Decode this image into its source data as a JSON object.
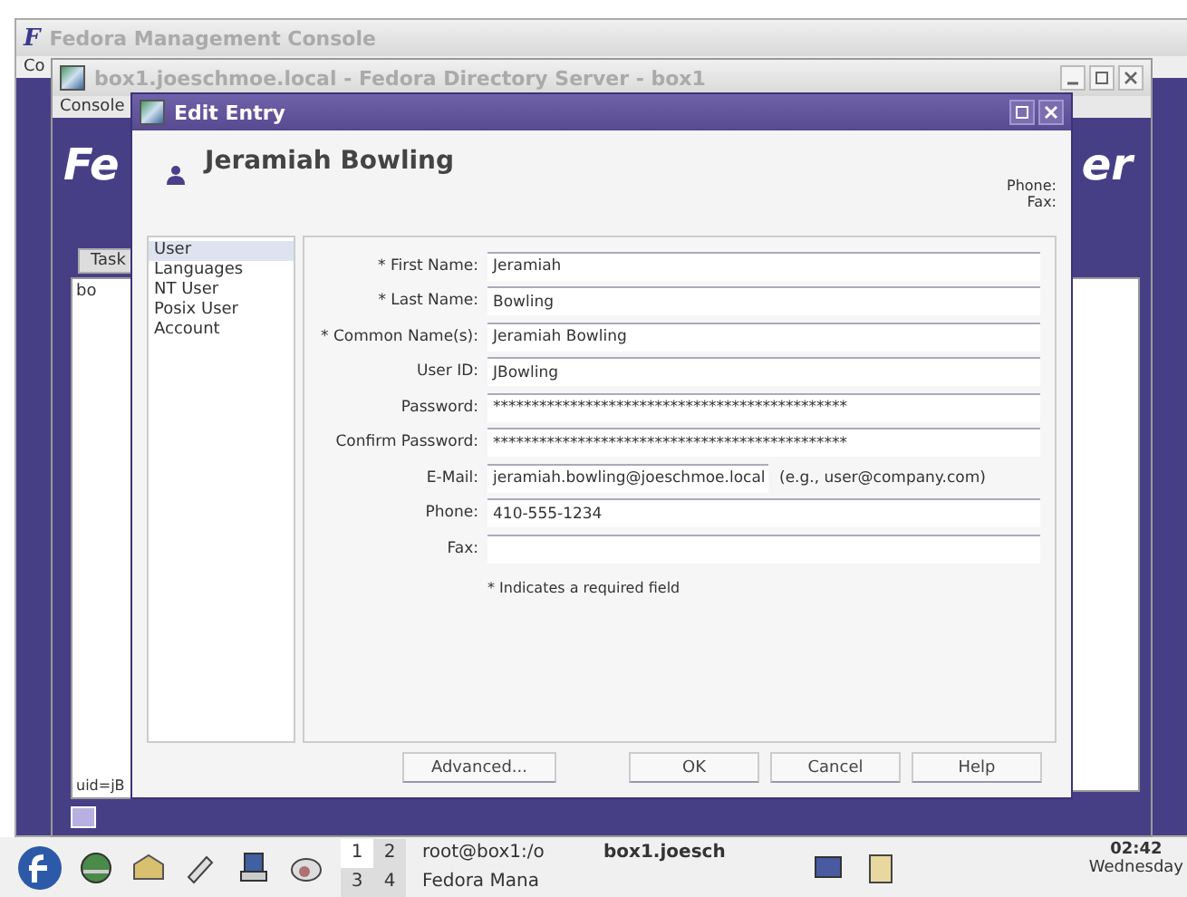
{
  "main_window": {
    "logo": "F",
    "title": "Fedora Management Console",
    "menu": "Co"
  },
  "server_window": {
    "title": "box1.joeschmoe.local - Fedora Directory Server - box1",
    "menu": "Console",
    "banner_left": "Fe",
    "banner_right": "er",
    "tab": "Task",
    "tree_label": "bo",
    "status_text": "uid=jB"
  },
  "dialog": {
    "title": "Edit Entry",
    "name": "Jeramiah Bowling",
    "phone_label": "Phone:",
    "fax_label": "Fax:",
    "sections": [
      {
        "label": "User",
        "selected": true
      },
      {
        "label": "Languages",
        "selected": false
      },
      {
        "label": "NT User",
        "selected": false
      },
      {
        "label": "Posix User",
        "selected": false
      },
      {
        "label": "Account",
        "selected": false
      }
    ],
    "fields": [
      {
        "label": "* First Name:",
        "value": "Jeramiah"
      },
      {
        "label": "* Last Name:",
        "value": "Bowling"
      },
      {
        "label": "* Common Name(s):",
        "value": "Jeramiah Bowling"
      },
      {
        "label": "User ID:",
        "value": "JBowling"
      },
      {
        "label": "Password:",
        "value": "**********************************************"
      },
      {
        "label": "Confirm Password:",
        "value": "**********************************************"
      },
      {
        "label": "E-Mail:",
        "value": "jeramiah.bowling@joeschmoe.local",
        "hint": "(e.g., user@company.com)"
      },
      {
        "label": "Phone:",
        "value": "410-555-1234"
      },
      {
        "label": "Fax:"
      }
    ],
    "required_note": "* Indicates a required field",
    "buttons": [
      "Advanced...",
      "OK",
      "Cancel",
      "Help"
    ]
  },
  "taskbar": {
    "workspaces": [
      {
        "label": "1",
        "selected": true
      },
      {
        "label": "2",
        "selected": false
      },
      {
        "label": "3",
        "selected": false
      },
      {
        "label": "4",
        "selected": false
      }
    ],
    "tasks": [
      {
        "label": "root@box1:/o",
        "selected": false
      },
      {
        "label": "box1.joesch",
        "selected": true
      },
      {
        "label": "Fedora Mana",
        "selected": false
      }
    ],
    "clock": "02:42",
    "day": "Wednesday"
  }
}
